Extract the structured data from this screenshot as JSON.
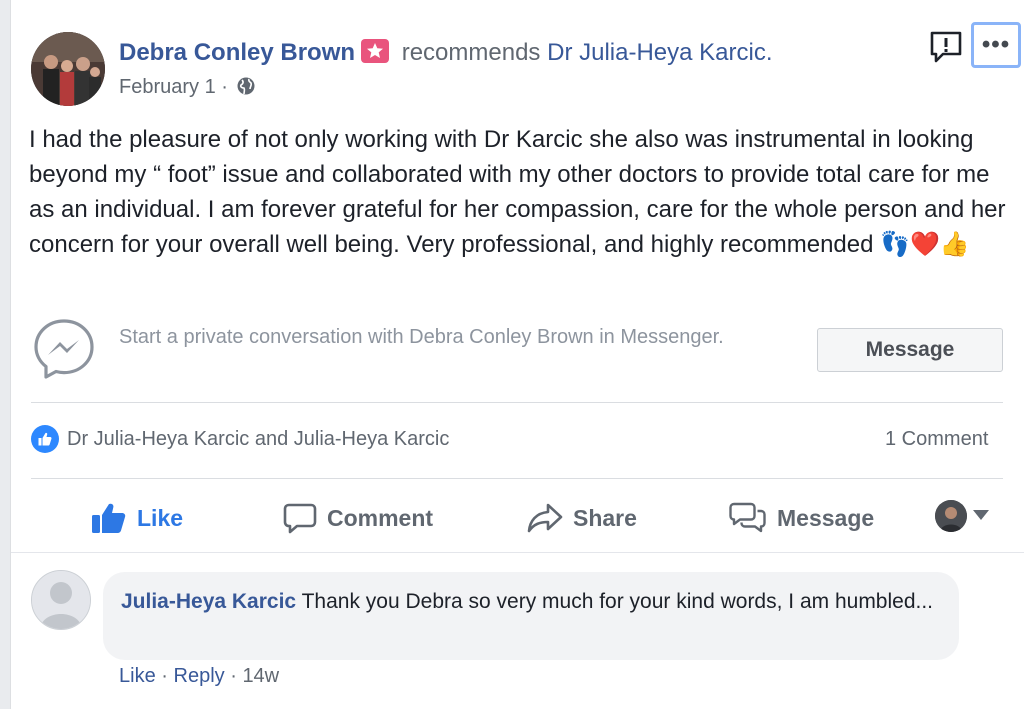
{
  "post": {
    "author": "Debra Conley Brown",
    "verb": "recommends",
    "target": "Dr Julia-Heya Karcic.",
    "date": "February 1 ·",
    "body": "I had the pleasure of not only working with Dr Karcic she also was instrumental in looking beyond my “ foot” issue and collaborated with my other doctors to provide total care for me as an individual. I am forever grateful for her compassion, care for the whole person and her concern for your overall well being. Very professional, and highly recommended",
    "emojis": "👣❤️👍",
    "icons": [
      "recommendation-star-icon",
      "globe-icon",
      "report-icon",
      "more-options-icon"
    ]
  },
  "messenger": {
    "prompt": "Start a private conversation with Debra Conley Brown in Messenger.",
    "button_label": "Message"
  },
  "reactions": {
    "names": "Dr Julia-Heya Karcic and Julia-Heya Karcic",
    "comment_count": "1 Comment"
  },
  "actions": {
    "like": "Like",
    "comment": "Comment",
    "share": "Share",
    "message": "Message"
  },
  "comment": {
    "author": "Julia-Heya Karcic",
    "text": "Thank you Debra so very much for your kind words, I am humbled...",
    "like": "Like",
    "separator": "·",
    "reply": "Reply",
    "time": "14w"
  },
  "colors": {
    "link": "#385898",
    "like_active": "#2d78e4",
    "muted": "#606770",
    "badge": "#e9547d"
  }
}
